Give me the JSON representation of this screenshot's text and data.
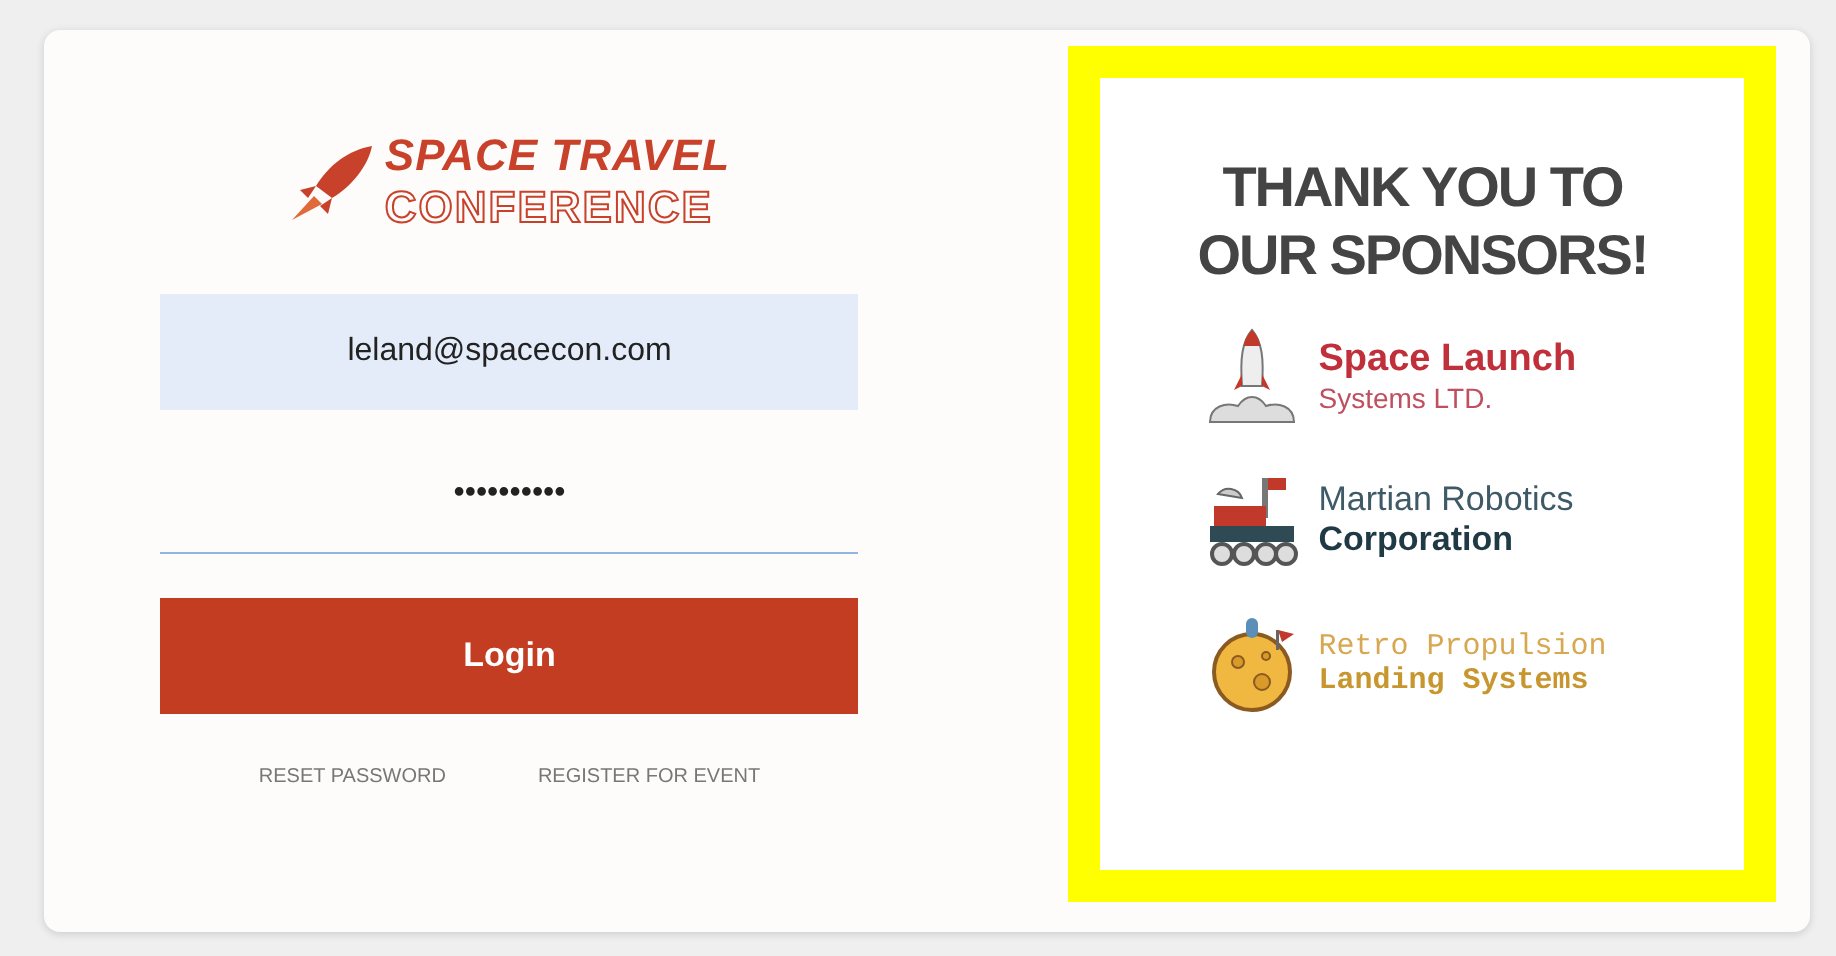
{
  "logo": {
    "line_1": "SPACE TRAVEL",
    "line_2": "CONFERENCE"
  },
  "email_field": {
    "value": "leland@spacecon.com"
  },
  "password_field": {
    "value": "••••••••••"
  },
  "login_button": {
    "label": "Login"
  },
  "links": [
    "RESET PASSWORD",
    "REGISTER FOR EVENT"
  ],
  "sponsors_panel": {
    "heading": "THANK YOU TO OUR SPONSORS!",
    "sponsors": [
      {
        "kind": "rocket",
        "name": "Space Launch",
        "subtitle": "Systems LTD."
      },
      {
        "kind": "rover",
        "name": "Martian Robotics",
        "subtitle": "Corporation"
      },
      {
        "kind": "planet",
        "name": "Retro Propulsion",
        "subtitle": "Landing Systems"
      }
    ]
  }
}
